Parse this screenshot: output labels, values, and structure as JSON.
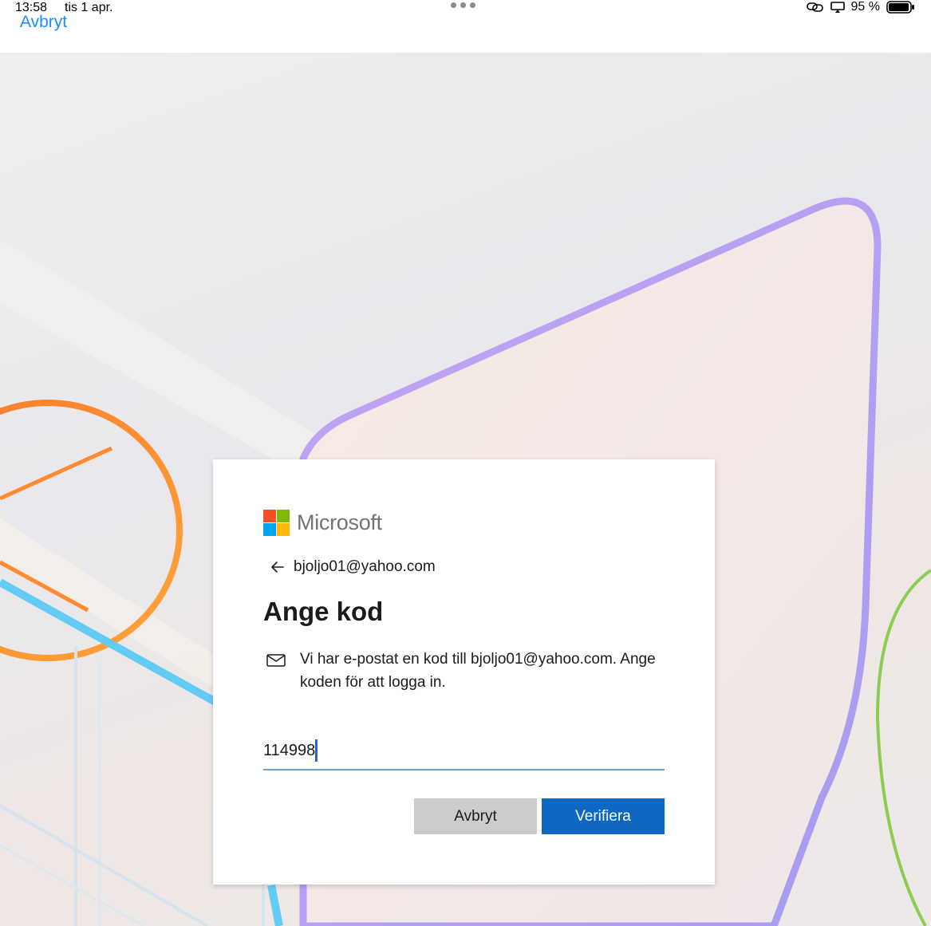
{
  "status_bar": {
    "time": "13:58",
    "date": "tis 1 apr.",
    "battery": "95 %"
  },
  "nav": {
    "cancel_label": "Avbryt"
  },
  "card": {
    "brand": "Microsoft",
    "identity_email": "bjoljo01@yahoo.com",
    "title": "Ange kod",
    "description": "Vi har e-postat en kod till bjoljo01@yahoo.com. Ange koden för att logga in.",
    "code_value": "114998",
    "cancel_button": "Avbryt",
    "verify_button": "Verifiera"
  },
  "colors": {
    "accent": "#0e67c0",
    "link": "#1a8cff",
    "ms_red": "#f25022",
    "ms_green": "#7fba00",
    "ms_blue": "#00a4ef",
    "ms_yellow": "#ffb900"
  },
  "icons": [
    "dots-icon",
    "screen-mirror-icon",
    "display-icon",
    "battery-icon",
    "back-arrow-icon",
    "mail-icon",
    "microsoft-logo-icon"
  ]
}
